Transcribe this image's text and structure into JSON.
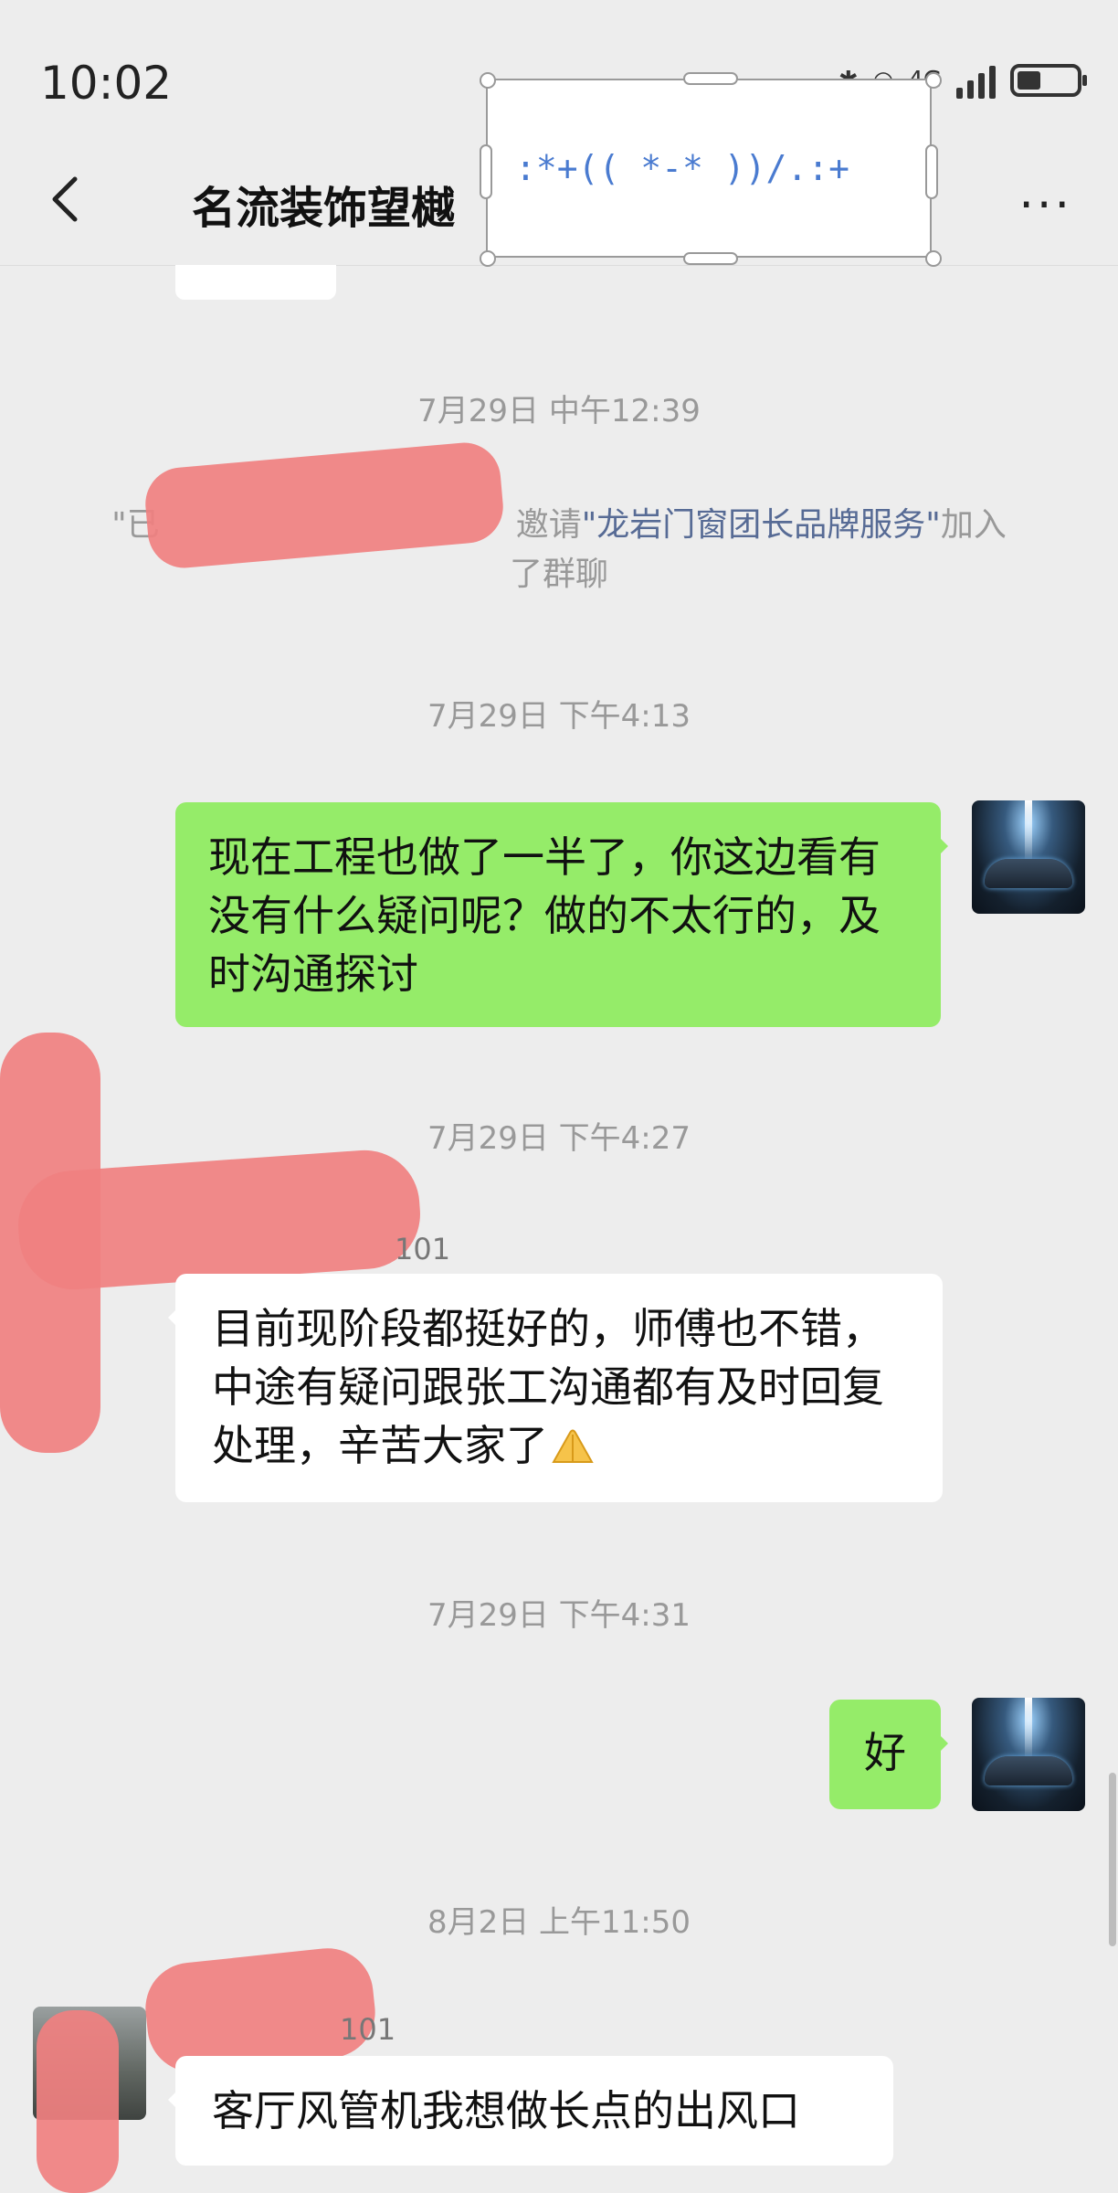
{
  "status_bar": {
    "time": "10:02",
    "network": "4G",
    "battery_percent": 40
  },
  "header": {
    "title": "名流装饰望樾",
    "more_label": "···"
  },
  "overlay": {
    "text": ":*+(( *-* ))/.:+"
  },
  "messages": {
    "ts1": "7月29日 中午12:39",
    "system1": {
      "prefix": "\"已",
      "invite": "邀请",
      "name": "\"龙岩门窗团长品牌服务\"",
      "suffix_line1": "加入",
      "line2": "了群聊"
    },
    "ts2": "7月29日 下午4:13",
    "msg1": "现在工程也做了一半了，你这边看有没有什么疑问呢？做的不太行的，及时沟通探讨",
    "ts3": "7月29日 下午4:27",
    "sender1": "101",
    "msg2": "目前现阶段都挺好的，师傅也不错，中途有疑问跟张工沟通都有及时回复处理，辛苦大家了",
    "ts4": "7月29日 下午4:31",
    "msg3": "好",
    "ts5": "8月2日 上午11:50",
    "sender2": "101",
    "msg4": "客厅风管机我想做长点的出风口"
  },
  "colors": {
    "my_bubble": "#95ec69",
    "other_bubble": "#ffffff",
    "background": "#ededed",
    "link": "#576b95"
  },
  "icons": {
    "back": "chevron-left-icon",
    "more": "more-icon",
    "emoji": "folded-hands-icon"
  }
}
